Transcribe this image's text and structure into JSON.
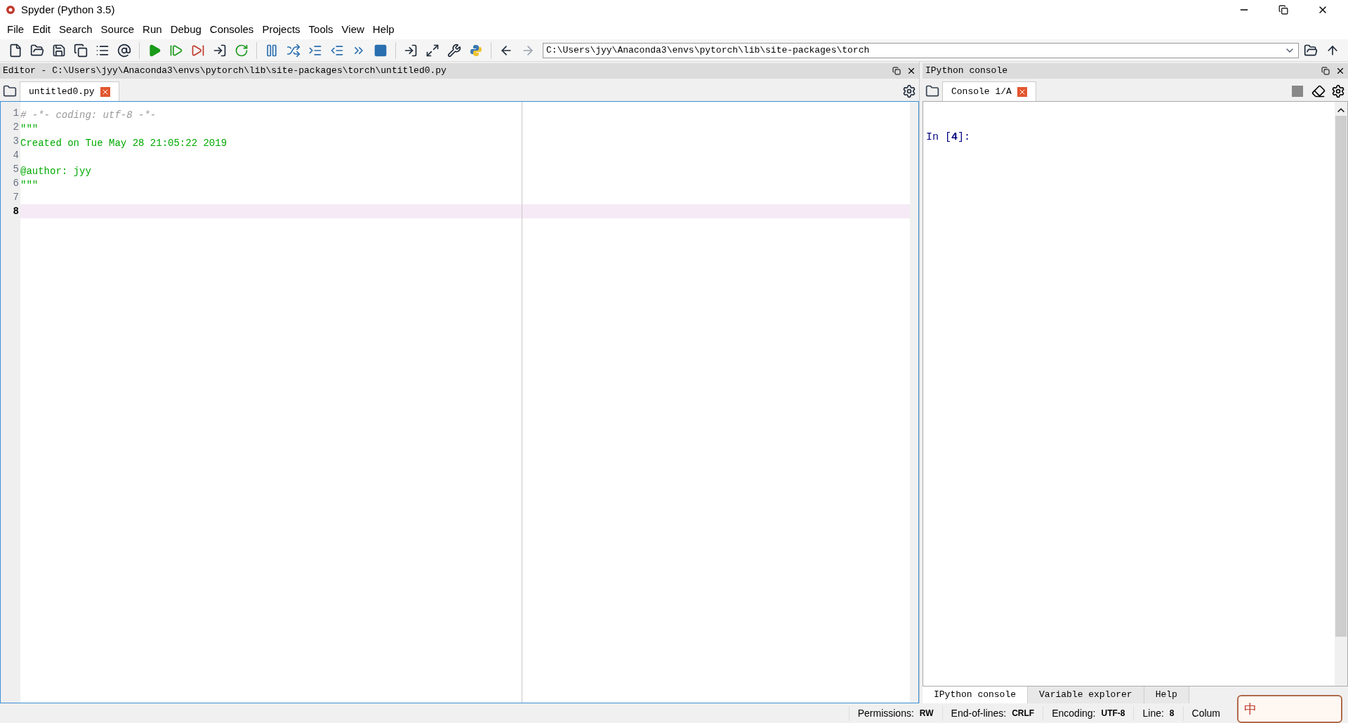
{
  "window": {
    "title": "Spyder (Python 3.5)"
  },
  "menu": [
    "File",
    "Edit",
    "Search",
    "Source",
    "Run",
    "Debug",
    "Consoles",
    "Projects",
    "Tools",
    "View",
    "Help"
  ],
  "path_field": {
    "value": "C:\\Users\\jyy\\Anaconda3\\envs\\pytorch\\lib\\site-packages\\torch"
  },
  "editor": {
    "title": "Editor - C:\\Users\\jyy\\Anaconda3\\envs\\pytorch\\lib\\site-packages\\torch\\untitled0.py",
    "tabs": [
      {
        "label": "untitled0.py",
        "selected": true
      }
    ],
    "lines": [
      {
        "number": "1",
        "kind": "comment",
        "text": "# -*- coding: utf-8 -*-",
        "current": false
      },
      {
        "number": "2",
        "kind": "string",
        "text": "\"\"\"",
        "current": false
      },
      {
        "number": "3",
        "kind": "string",
        "text": "Created on Tue May 28 21:05:22 2019",
        "current": false
      },
      {
        "number": "4",
        "current": false
      },
      {
        "number": "5",
        "kind": "string",
        "text": "@author: jyy",
        "current": false
      },
      {
        "number": "6",
        "kind": "string",
        "text": "\"\"\"",
        "current": false
      },
      {
        "number": "7",
        "current": false
      },
      {
        "number": "8",
        "current": true
      }
    ]
  },
  "console": {
    "title": "IPython console",
    "tabs": [
      {
        "label": "Console 1/A",
        "selected": true
      }
    ],
    "prompt": {
      "label": "In [",
      "number": "4",
      "end": "]:"
    },
    "bottom_tabs": [
      {
        "label": "IPython console",
        "selected": true
      },
      {
        "label": "Variable explorer",
        "selected": false
      },
      {
        "label": "Help",
        "selected": false
      }
    ]
  },
  "status_bar": [
    {
      "label": "Permissions:",
      "value": "RW"
    },
    {
      "label": "End-of-lines:",
      "value": "CRLF"
    },
    {
      "label": "Encoding:",
      "value": "UTF-8"
    },
    {
      "label": "Line:",
      "value": "8"
    },
    {
      "label": "Colum"
    }
  ],
  "ime_widget": {
    "text": "中"
  }
}
